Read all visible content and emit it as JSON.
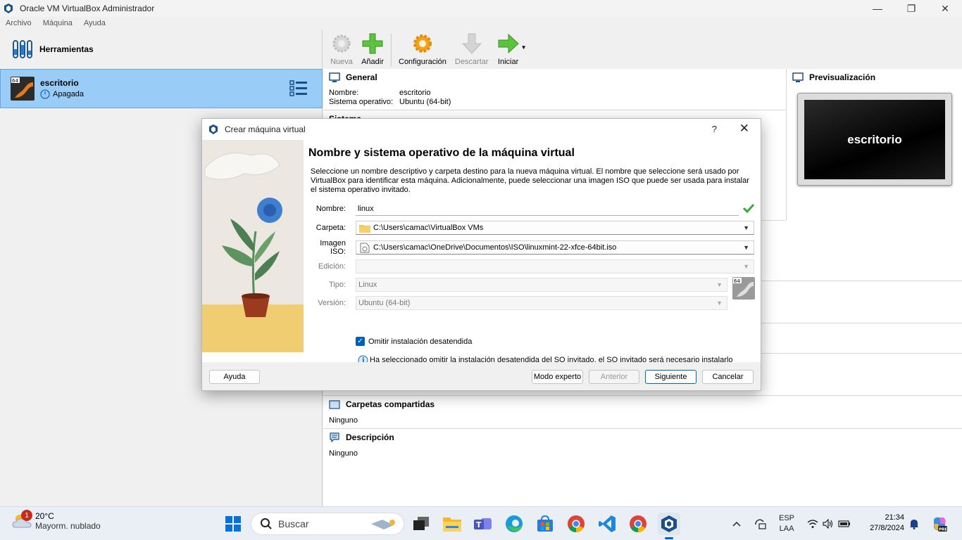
{
  "window": {
    "title": "Oracle VM VirtualBox Administrador",
    "controls": {
      "minimize": "—",
      "restore": "❐",
      "close": "✕"
    }
  },
  "menu": [
    "Archivo",
    "Máquina",
    "Ayuda"
  ],
  "tools_label": "Herramientas",
  "vm": {
    "name": "escritorio",
    "state": "Apagada"
  },
  "toolbar": {
    "nueva": "Nueva",
    "anadir": "Añadir",
    "configuracion": "Configuración",
    "descartar": "Descartar",
    "iniciar": "Iniciar"
  },
  "details": {
    "general_title": "General",
    "nombre_key": "Nombre:",
    "nombre_val": "escritorio",
    "so_key": "Sistema operativo:",
    "so_val": "Ubuntu (64-bit)",
    "sistema_title": "Sistema",
    "carpetas_title": "Carpetas compartidas",
    "carpetas_val": "Ninguno",
    "descripcion_title": "Descripción",
    "descripcion_val": "Ninguno"
  },
  "preview": {
    "title": "Previsualización",
    "screen_text": "escritorio"
  },
  "dialog": {
    "title": "Crear máquina virtual",
    "help": "?",
    "close": "✕",
    "heading": "Nombre y sistema operativo de la máquina virtual",
    "description": "Seleccione un nombre descriptivo y carpeta destino para la nueva máquina virtual. El nombre que seleccione será usado por VirtualBox para identificar esta máquina. Adicionalmente, puede seleccionar una imagen ISO que puede ser usada para instalar el sistema operativo invitado.",
    "fields": {
      "nombre_label": "Nombre:",
      "nombre_value": "linux",
      "carpeta_label": "Carpeta:",
      "carpeta_value": "C:\\Users\\camac\\VirtualBox VMs",
      "iso_label": "Imagen ISO:",
      "iso_value": "C:\\Users\\camac\\OneDrive\\Documentos\\ISO\\linuxmint-22-xfce-64bit.iso",
      "edicion_label": "Edición:",
      "edicion_value": "",
      "tipo_label": "Tipo:",
      "tipo_value": "Linux",
      "version_label": "Versión:",
      "version_value": "Ubuntu (64-bit)"
    },
    "checkbox_label": "Omitir instalación desatendida",
    "checkbox_checked": true,
    "info_text": "Ha seleccionado omitir la instalación desatendida del SO invitado, el SO invitado será necesario instalarlo manualmente.",
    "buttons": {
      "ayuda": "Ayuda",
      "experto": "Modo experto",
      "anterior": "Anterior",
      "siguiente": "Siguiente",
      "cancelar": "Cancelar"
    }
  },
  "taskbar": {
    "weather_temp": "20°C",
    "weather_desc": "Mayorm. nublado",
    "weather_badge": "1",
    "search_placeholder": "Buscar",
    "lang1": "ESP",
    "lang2": "LAA",
    "time": "21:34",
    "date": "27/8/2024"
  }
}
